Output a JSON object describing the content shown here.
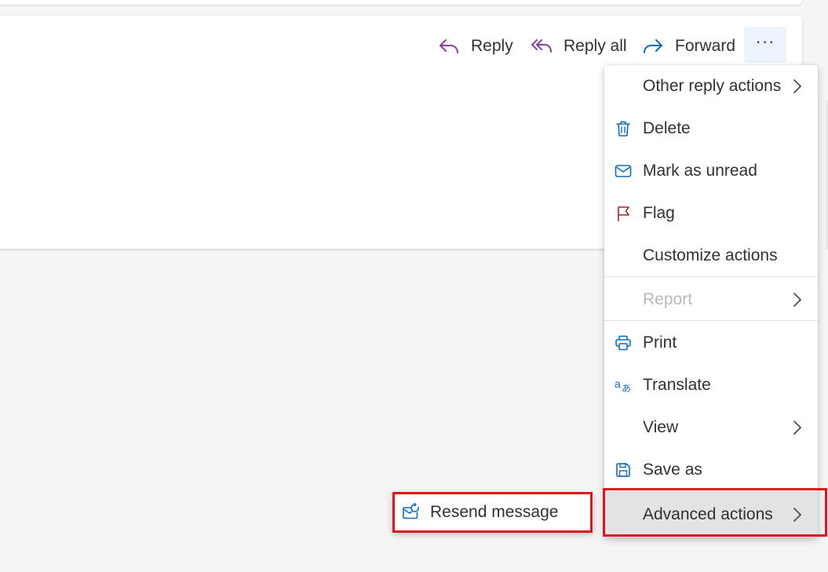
{
  "action_bar": {
    "reply_label": "Reply",
    "reply_all_label": "Reply all",
    "forward_label": "Forward",
    "more_label": "···"
  },
  "menu": {
    "items": [
      {
        "label": "Other reply actions",
        "icon": "none",
        "submenu": true
      },
      {
        "label": "Delete",
        "icon": "trash-icon"
      },
      {
        "label": "Mark as unread",
        "icon": "envelope-icon"
      },
      {
        "label": "Flag",
        "icon": "flag-icon"
      },
      {
        "label": "Customize actions",
        "icon": "none"
      },
      {
        "label": "Report",
        "icon": "none",
        "submenu": true,
        "disabled": true
      },
      {
        "label": "Print",
        "icon": "printer-icon"
      },
      {
        "label": "Translate",
        "icon": "translate-icon"
      },
      {
        "label": "View",
        "icon": "none",
        "submenu": true
      },
      {
        "label": "Save as",
        "icon": "save-icon"
      },
      {
        "label": "Advanced actions",
        "icon": "none",
        "submenu": true,
        "active": true
      }
    ]
  },
  "submenu": {
    "items": [
      {
        "label": "Resend message",
        "icon": "resend-icon"
      }
    ]
  },
  "colors": {
    "accent_blue": "#0f6cbd",
    "reply_purple": "#8a3f9c",
    "flag_red": "#a4262c",
    "highlight_red": "#e0141c",
    "active_bg": "#e3e3e3",
    "more_button_bg": "#ebf3fc"
  }
}
